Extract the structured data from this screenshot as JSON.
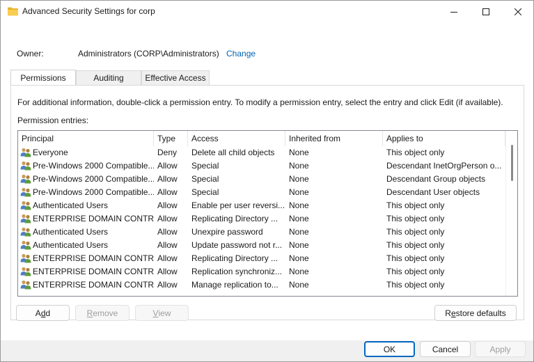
{
  "window": {
    "title": "Advanced Security Settings for corp"
  },
  "owner": {
    "label": "Owner:",
    "value": "Administrators (CORP\\Administrators)",
    "change_link": "Change"
  },
  "tabs": [
    {
      "label": "Permissions",
      "active": true
    },
    {
      "label": "Auditing",
      "active": false
    },
    {
      "label": "Effective Access",
      "active": false
    }
  ],
  "permissions": {
    "info": "For additional information, double-click a permission entry. To modify a permission entry, select the entry and click Edit (if available).",
    "entries_label": "Permission entries:",
    "columns": [
      "Principal",
      "Type",
      "Access",
      "Inherited from",
      "Applies to"
    ],
    "rows": [
      {
        "principal": "Everyone",
        "type": "Deny",
        "access": "Delete all child objects",
        "inherited": "None",
        "applies": "This object only"
      },
      {
        "principal": "Pre-Windows 2000 Compatible...",
        "type": "Allow",
        "access": "Special",
        "inherited": "None",
        "applies": "Descendant InetOrgPerson o..."
      },
      {
        "principal": "Pre-Windows 2000 Compatible...",
        "type": "Allow",
        "access": "Special",
        "inherited": "None",
        "applies": "Descendant Group objects"
      },
      {
        "principal": "Pre-Windows 2000 Compatible...",
        "type": "Allow",
        "access": "Special",
        "inherited": "None",
        "applies": "Descendant User objects"
      },
      {
        "principal": "Authenticated Users",
        "type": "Allow",
        "access": "Enable per user reversi...",
        "inherited": "None",
        "applies": "This object only"
      },
      {
        "principal": "ENTERPRISE DOMAIN CONTR...",
        "type": "Allow",
        "access": "Replicating Directory ...",
        "inherited": "None",
        "applies": "This object only"
      },
      {
        "principal": "Authenticated Users",
        "type": "Allow",
        "access": "Unexpire password",
        "inherited": "None",
        "applies": "This object only"
      },
      {
        "principal": "Authenticated Users",
        "type": "Allow",
        "access": "Update password not r...",
        "inherited": "None",
        "applies": "This object only"
      },
      {
        "principal": "ENTERPRISE DOMAIN CONTR...",
        "type": "Allow",
        "access": "Replicating Directory ...",
        "inherited": "None",
        "applies": "This object only"
      },
      {
        "principal": "ENTERPRISE DOMAIN CONTR...",
        "type": "Allow",
        "access": "Replication synchroniz...",
        "inherited": "None",
        "applies": "This object only"
      },
      {
        "principal": "ENTERPRISE DOMAIN CONTR...",
        "type": "Allow",
        "access": "Manage replication to...",
        "inherited": "None",
        "applies": "This object only"
      }
    ]
  },
  "buttons": {
    "add": "Add",
    "remove": "Remove",
    "view": "View",
    "restore_defaults": "Restore defaults",
    "ok": "OK",
    "cancel": "Cancel",
    "apply": "Apply"
  },
  "icons": {
    "title": "folder-icon",
    "principal": "users-group-icon"
  },
  "colors": {
    "link": "#0063b1",
    "focus": "#0067c0"
  }
}
